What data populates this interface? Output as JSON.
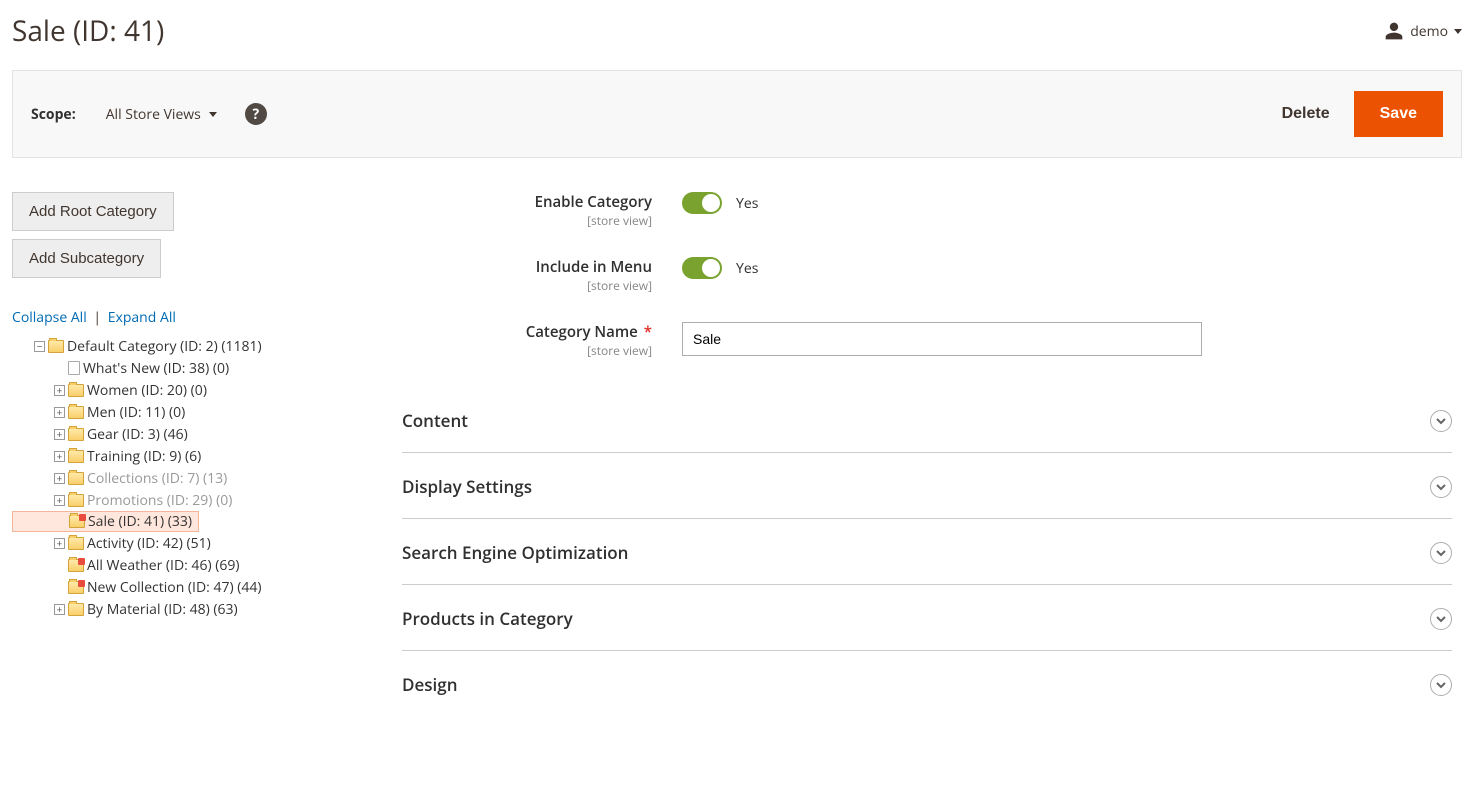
{
  "page_title": "Sale (ID: 41)",
  "user": {
    "name": "demo"
  },
  "toolbar": {
    "scope_label": "Scope:",
    "scope_value": "All Store Views",
    "delete": "Delete",
    "save": "Save"
  },
  "sidebar": {
    "add_root": "Add Root Category",
    "add_sub": "Add Subcategory",
    "collapse_all": "Collapse All",
    "expand_all": "Expand All",
    "tree": {
      "root": "Default Category (ID: 2) (1181)",
      "children": [
        {
          "label": "What's New (ID: 38) (0)",
          "icon": "page",
          "expandable": false
        },
        {
          "label": "Women (ID: 20) (0)",
          "icon": "folder",
          "expandable": true
        },
        {
          "label": "Men (ID: 11) (0)",
          "icon": "folder",
          "expandable": true
        },
        {
          "label": "Gear (ID: 3) (46)",
          "icon": "folder",
          "expandable": true
        },
        {
          "label": "Training (ID: 9) (6)",
          "icon": "folder",
          "expandable": true
        },
        {
          "label": "Collections (ID: 7) (13)",
          "icon": "folder",
          "expandable": true,
          "muted": true
        },
        {
          "label": "Promotions (ID: 29) (0)",
          "icon": "folder",
          "expandable": true,
          "muted": true
        },
        {
          "label": "Sale (ID: 41) (33)",
          "icon": "special",
          "expandable": false,
          "selected": true
        },
        {
          "label": "Activity (ID: 42) (51)",
          "icon": "folder",
          "expandable": true
        },
        {
          "label": "All Weather (ID: 46) (69)",
          "icon": "special",
          "expandable": false
        },
        {
          "label": "New Collection (ID: 47) (44)",
          "icon": "special",
          "expandable": false
        },
        {
          "label": "By Material (ID: 48) (63)",
          "icon": "folder",
          "expandable": true
        }
      ]
    }
  },
  "form": {
    "enable_category": {
      "label": "Enable Category",
      "sub": "[store view]",
      "value": "Yes"
    },
    "include_in_menu": {
      "label": "Include in Menu",
      "sub": "[store view]",
      "value": "Yes"
    },
    "category_name": {
      "label": "Category Name",
      "sub": "[store view]",
      "value": "Sale"
    }
  },
  "sections": [
    "Content",
    "Display Settings",
    "Search Engine Optimization",
    "Products in Category",
    "Design"
  ]
}
